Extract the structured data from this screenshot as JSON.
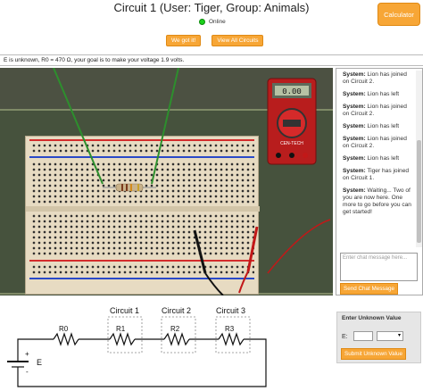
{
  "header": {
    "title": "Circuit 1 (User: Tiger, Group: Animals)",
    "status": "Online",
    "got_it_label": "We got it!",
    "view_all_label": "View All Circuits",
    "calculator_label": "Calculator"
  },
  "instruction": "E is unknown, R0 = 470 Ω, your goal is to make your voltage 1.9 volts.",
  "chat": {
    "messages": [
      {
        "sender": "System:",
        "text": "Lion has joined on Circuit 2."
      },
      {
        "sender": "System:",
        "text": "Lion has left"
      },
      {
        "sender": "System:",
        "text": "Lion has joined on Circuit 2."
      },
      {
        "sender": "System:",
        "text": "Lion has left"
      },
      {
        "sender": "System:",
        "text": "Lion has joined on Circuit 2."
      },
      {
        "sender": "System:",
        "text": "Lion has left"
      },
      {
        "sender": "System:",
        "text": "Tiger has joined on Circuit 1."
      },
      {
        "sender": "System:",
        "text": "Waiting... Two of you are now here. One more to go before you can get started!"
      }
    ],
    "input_placeholder": "Enter chat message here...",
    "send_label": "Send Chat Message"
  },
  "multimeter": {
    "display": "0.00",
    "brand": "CEN-TECH"
  },
  "circuit": {
    "labels": {
      "r0": "R0",
      "r1": "R1",
      "r2": "R2",
      "r3": "R3",
      "e": "E",
      "plus": "+",
      "minus": "-"
    },
    "slots": [
      "Circuit 1",
      "Circuit 2",
      "Circuit 3"
    ]
  },
  "unknown": {
    "title": "Enter Unknown Value",
    "e_label": "E:",
    "select_value": "▾",
    "submit_label": "Submit Unknown Value"
  },
  "colors": {
    "accent": "#f7a636",
    "online": "#1bd11b",
    "mat": "#46523d",
    "breadboard": "#e7dbc2"
  }
}
